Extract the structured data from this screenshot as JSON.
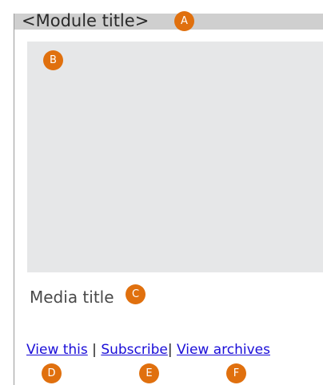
{
  "module": {
    "title": "<Module title>",
    "media_title": "Media title"
  },
  "links": {
    "view_this": "View this",
    "sep1": " | ",
    "subscribe": "Subscribe",
    "sep2": "| ",
    "view_archives": "View archives"
  },
  "badges": {
    "a": "A",
    "b": "B",
    "c": "C",
    "d": "D",
    "e": "E",
    "f": "F"
  },
  "colors": {
    "title_bar": "#cfcfcf",
    "media_placeholder": "#e6e7e8",
    "badge": "#e0700e",
    "link": "#1a0dd8"
  }
}
